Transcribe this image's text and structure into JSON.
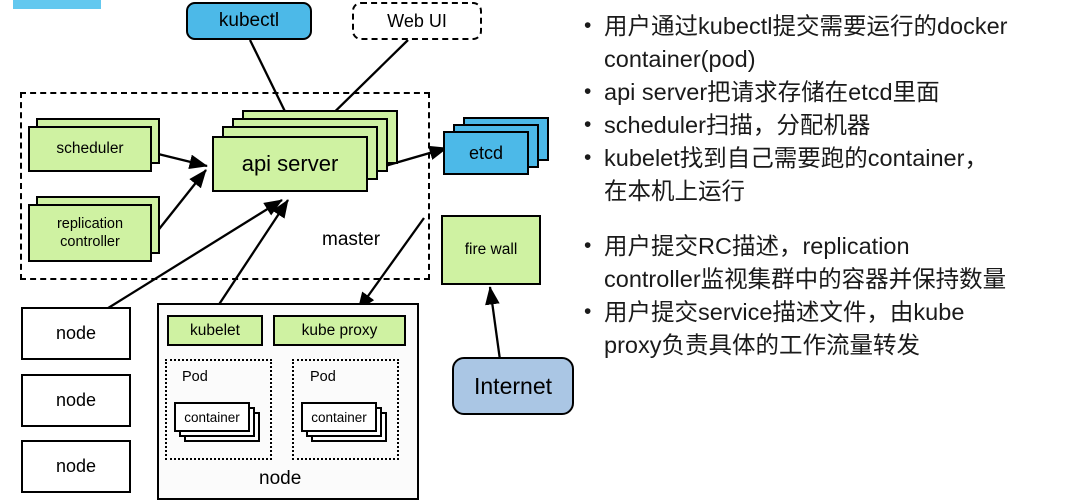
{
  "slide": {
    "title_bar_color": "#63c8ef",
    "palette": {
      "green": "#cff2a2",
      "blue": "#4cb9e8",
      "light_blue": "#aac6e4",
      "white": "#ffffff",
      "stroke": "#000000"
    }
  },
  "diagram": {
    "nodes": {
      "kubectl": "kubectl",
      "web_ui": "Web UI",
      "scheduler": "scheduler",
      "replication_controller_line1": "replication",
      "replication_controller_line2": "controller",
      "api_server": "api server",
      "etcd": "etcd",
      "fire_wall": "fire wall",
      "internet": "Internet",
      "kubelet": "kubelet",
      "kube_proxy": "kube proxy",
      "container_left": "container",
      "container_right": "container",
      "pod_left": "Pod",
      "pod_right": "Pod",
      "node_1": "node",
      "node_2": "node",
      "node_3": "node",
      "node_detail": "node",
      "master": "master"
    }
  },
  "notes": {
    "group_one": [
      "用户通过kubectl提交需要运行的docker",
      "container(pod)",
      "api server把请求存储在etcd里面",
      "scheduler扫描，分配机器",
      "kubelet找到自己需要跑的container，",
      "在本机上运行"
    ],
    "group_two": [
      "用户提交RC描述，replication",
      "controller监视集群中的容器并保持数量",
      "用户提交service描述文件，由kube",
      "proxy负责具体的工作流量转发"
    ],
    "bullets": [
      {
        "lines": [
          "用户通过kubectl提交需要运行的docker",
          "container(pod)"
        ]
      },
      {
        "lines": [
          "api server把请求存储在etcd里面"
        ]
      },
      {
        "lines": [
          "scheduler扫描，分配机器"
        ]
      },
      {
        "lines": [
          "kubelet找到自己需要跑的container，",
          "在本机上运行"
        ]
      },
      {
        "lines": [
          "用户提交RC描述，replication",
          "controller监视集群中的容器并保持数量"
        ]
      },
      {
        "lines": [
          "用户提交service描述文件，由kube",
          "proxy负责具体的工作流量转发"
        ]
      }
    ]
  }
}
